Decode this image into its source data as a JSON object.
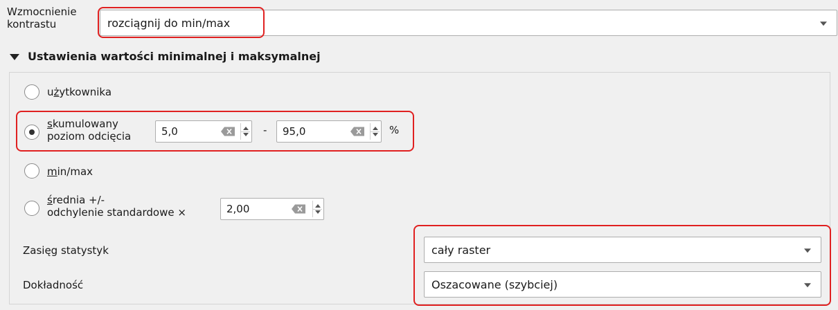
{
  "contrast": {
    "label": "Wzmocnienie kontrastu",
    "value": "rozciągnij do min/max"
  },
  "group": {
    "title": "Ustawienia wartości minimalnej i maksymalnej"
  },
  "options": {
    "user": {
      "label": "użytkownika",
      "checked": false
    },
    "cumulative": {
      "label_line1": "skumulowany",
      "label_line2": "poziom odcięcia",
      "checked": true,
      "min_value": "5,0",
      "separator": "-",
      "max_value": "95,0",
      "unit": "%"
    },
    "minmax": {
      "label": "min/max",
      "checked": false
    },
    "stddev": {
      "label_line1": "średnia +/-",
      "label_line2": "odchylenie standardowe ×",
      "checked": false,
      "value": "2,00"
    }
  },
  "statistics_extent": {
    "label": "Zasięg statystyk",
    "value": "cały raster"
  },
  "accuracy": {
    "label": "Dokładność",
    "value": "Oszacowane (szybciej)"
  },
  "colors": {
    "highlight": "#e02020",
    "background": "#f0f0f0"
  }
}
